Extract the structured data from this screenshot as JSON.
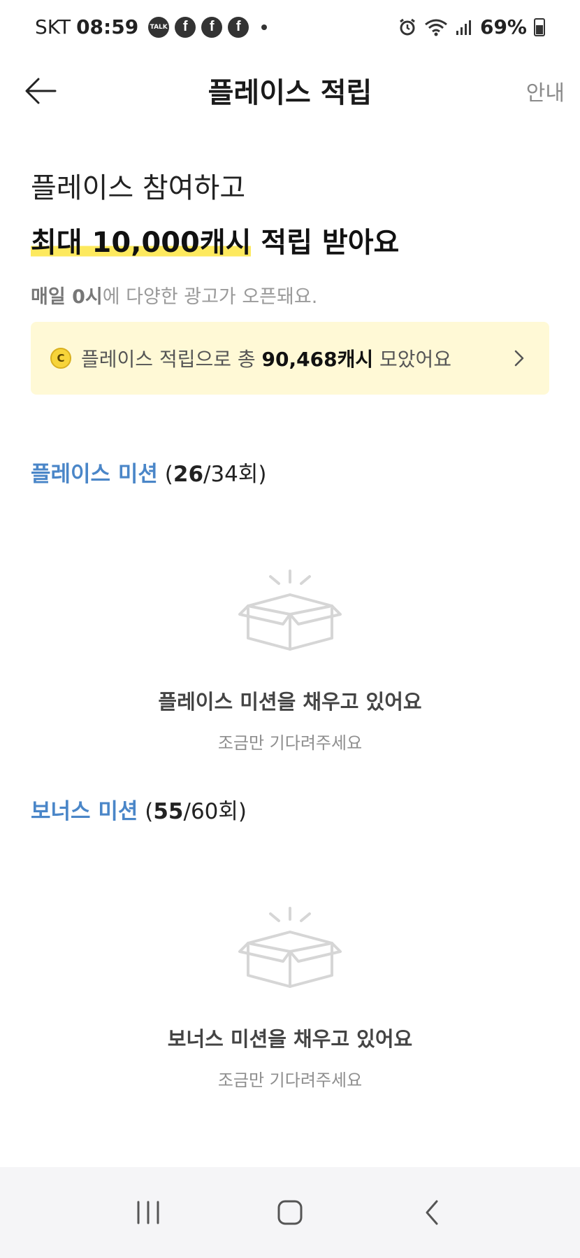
{
  "status_bar": {
    "carrier": "SKT",
    "time": "08:59",
    "notifications": [
      "talk-icon",
      "facebook-icon",
      "facebook-icon",
      "facebook-icon"
    ],
    "talk_label": "TALK",
    "fb_glyph": "f",
    "battery": "69%"
  },
  "header": {
    "title": "플레이스 적립",
    "guide": "안내"
  },
  "hero": {
    "line1": "플레이스 참여하고",
    "line2_highlight": "최대 10,000캐시",
    "line2_rest": " 적립 받아요",
    "sub_bold": "매일 0시",
    "sub_rest": "에 다양한 광고가 오픈돼요."
  },
  "summary": {
    "coin": "C",
    "prefix": "플레이스 적립으로 총 ",
    "amount": "90,468캐시",
    "suffix": " 모았어요"
  },
  "place_mission": {
    "name": "플레이스 미션",
    "open": " (",
    "done": "26",
    "rest": "/34회)",
    "empty_title": "플레이스 미션을 채우고 있어요",
    "empty_sub": "조금만 기다려주세요"
  },
  "bonus_mission": {
    "name": "보너스 미션",
    "open": " (",
    "done": "55",
    "rest": "/60회)",
    "empty_title": "보너스 미션을 채우고 있어요",
    "empty_sub": "조금만 기다려주세요"
  },
  "nav_bar": {
    "icons": [
      "recent-apps-icon",
      "home-icon",
      "back-icon"
    ]
  },
  "colors": {
    "accent_blue": "#4a86c8",
    "highlight_yellow": "#fde95e",
    "summary_bg": "#fff9d6"
  }
}
